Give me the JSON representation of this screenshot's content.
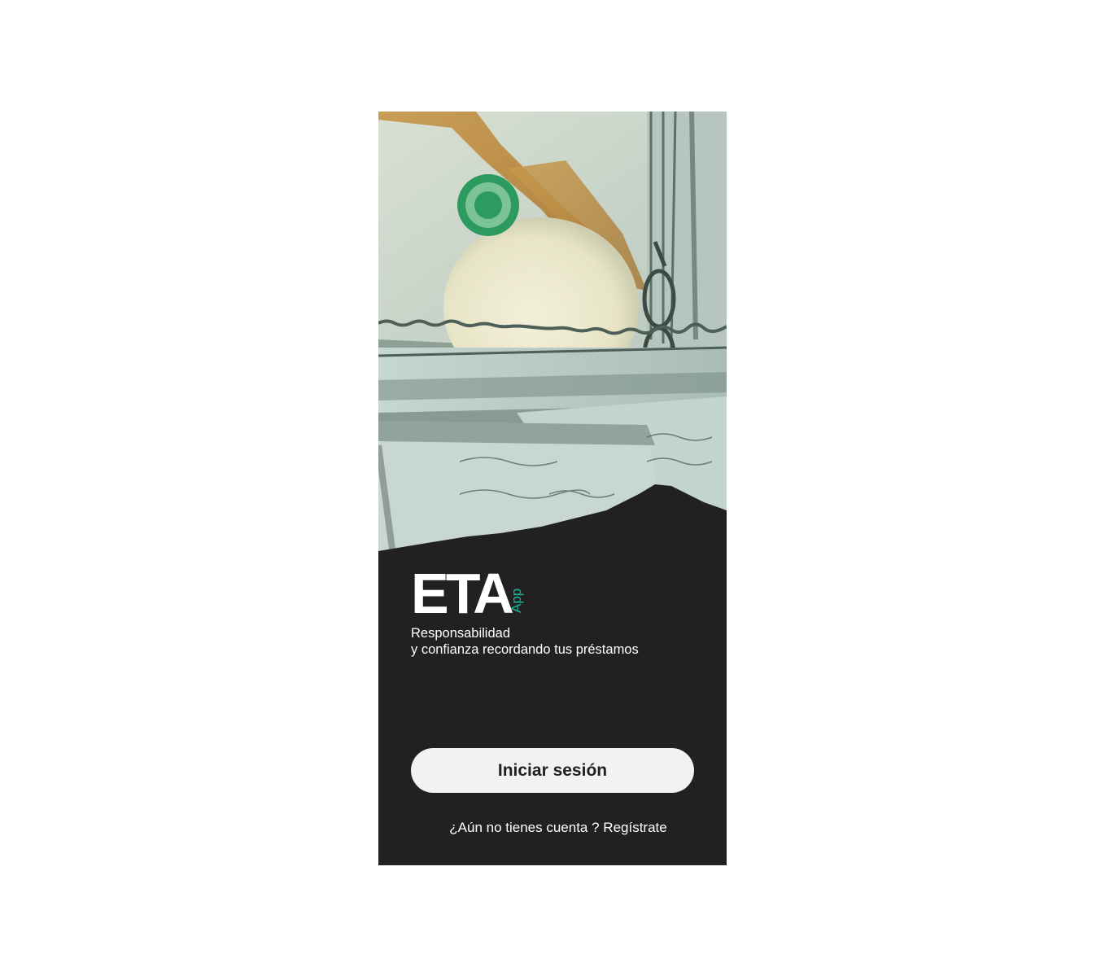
{
  "logo": {
    "main": "ETA",
    "sub": "App"
  },
  "tagline": {
    "line1": "Responsabilidad",
    "line2": "y confianza recordando tus préstamos"
  },
  "login_button": {
    "label": "Iniciar sesión"
  },
  "register": {
    "prompt": "¿Aún no tienes cuenta ?",
    "link": "Regístrate"
  },
  "hero": {
    "image": "hundred-dollar-bills-photo"
  },
  "colors": {
    "background": "#212121",
    "accent": "#1bb59a",
    "button": "#f2f2f2",
    "text": "#ffffff"
  }
}
